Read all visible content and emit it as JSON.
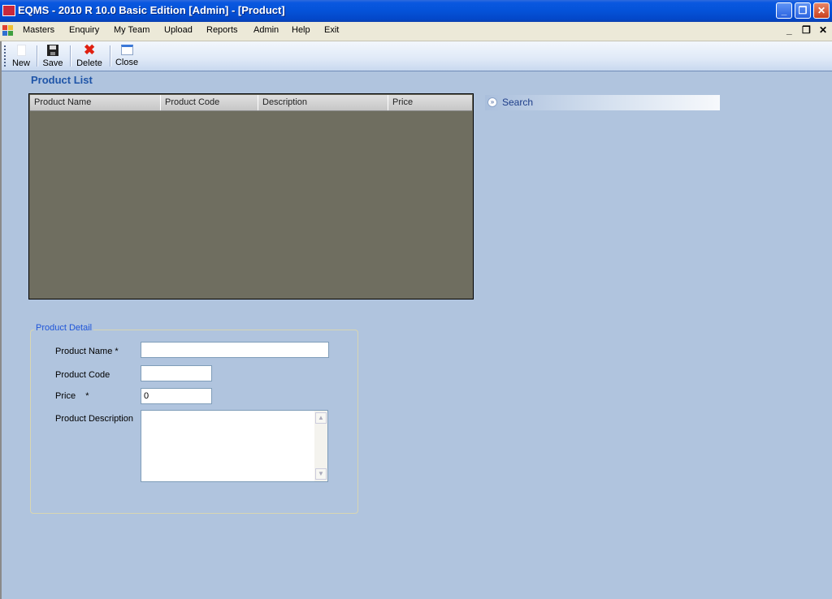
{
  "window": {
    "title": "EQMS - 2010 R 10.0  Basic Edition [Admin] - [Product]",
    "controls": {
      "minimize": "_",
      "restore": "❐",
      "close": "✕"
    }
  },
  "menubar": {
    "items": [
      "Masters",
      "Enquiry",
      "My Team",
      "Upload",
      "Reports",
      "Admin",
      "Help",
      "Exit"
    ],
    "mdi_controls": {
      "minimize": "_",
      "restore": "❐",
      "close": "✕"
    }
  },
  "toolbar": {
    "buttons": [
      {
        "label": "New",
        "icon": "new-document-icon"
      },
      {
        "label": "Save",
        "icon": "floppy-disk-icon"
      },
      {
        "label": "Delete",
        "icon": "red-x-icon"
      },
      {
        "label": "Close",
        "icon": "window-close-icon"
      }
    ]
  },
  "product_list": {
    "title": "Product List",
    "columns": [
      "Product Name",
      "Product Code",
      "Description",
      "Price"
    ],
    "rows": []
  },
  "search": {
    "label": "Search",
    "icon": "chevron-double-down-icon"
  },
  "product_detail": {
    "title": "Product Detail",
    "fields": {
      "product_name": {
        "label": "Product Name  *",
        "value": ""
      },
      "product_code": {
        "label": "Product Code",
        "value": ""
      },
      "price": {
        "label": "Price    *",
        "value": "0"
      },
      "product_description": {
        "label": "Product Description",
        "value": ""
      }
    },
    "scroll_up": "▲",
    "scroll_down": "▼"
  },
  "colors": {
    "title_bar": "#0452d8",
    "background": "#b0c4de",
    "grid_body": "#6f6e60",
    "heading": "#1f55a8"
  }
}
